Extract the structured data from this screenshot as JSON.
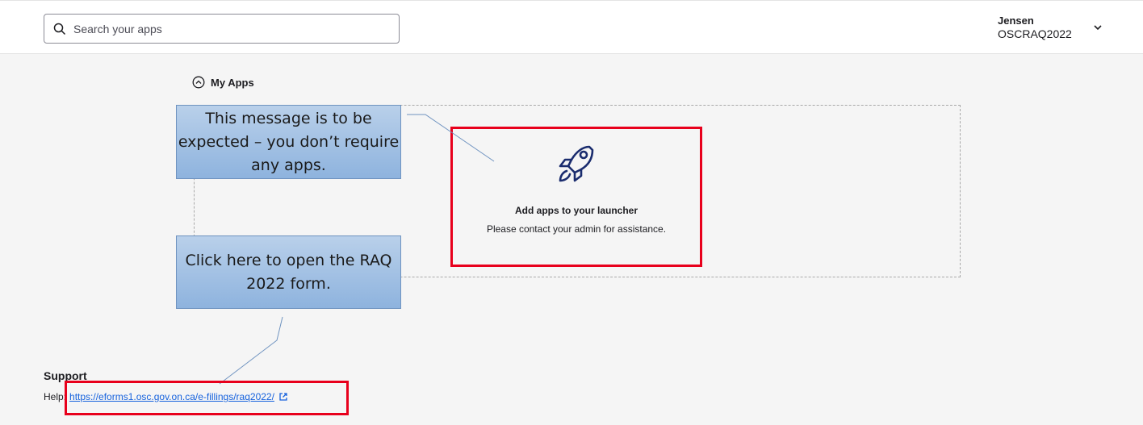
{
  "search": {
    "placeholder": "Search your apps"
  },
  "user": {
    "name": "Jensen",
    "org": "OSCRAQ2022"
  },
  "section": {
    "title": "My Apps"
  },
  "empty_state": {
    "title": "Add apps to your launcher",
    "subtitle": "Please contact your admin for assistance."
  },
  "callouts": [
    {
      "text": "This message is to be expected – you don’t require any apps."
    },
    {
      "text": "Click here to open the RAQ 2022 form."
    }
  ],
  "support": {
    "title": "Support",
    "help_label": "Help:",
    "help_link": "https://eforms1.osc.gov.on.ca/e-fillings/raq2022/"
  },
  "colors": {
    "highlight": "#e8001c",
    "link": "#1662dd",
    "icon": "#1a2c6e",
    "callout_fill": "#8eb3de"
  },
  "icons": [
    "search-icon",
    "chevron-down-icon",
    "chevron-up-circle-icon",
    "rocket-icon",
    "external-link-icon"
  ]
}
